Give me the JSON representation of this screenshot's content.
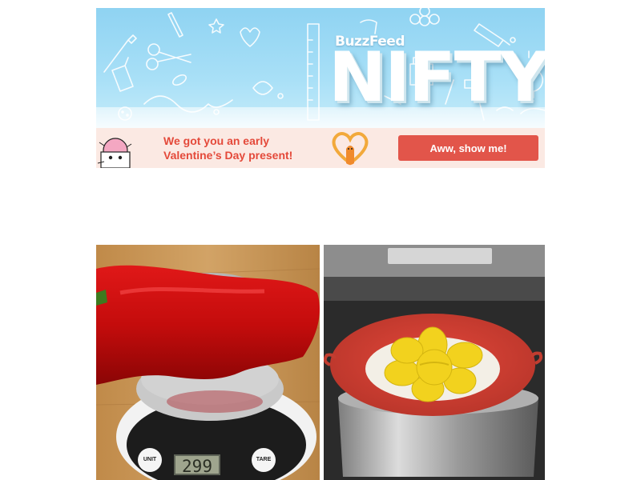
{
  "banner": {
    "brand": "BuzzFeed",
    "title": "NIFTY",
    "illustration_icons": [
      "scissors-icon",
      "lightbulb-icon",
      "hammer-icon",
      "paintbrush-icon",
      "pencil-icon",
      "glue-bottle-icon",
      "ruler-icon",
      "leaf-icon",
      "button-icon",
      "safety-pin-icon"
    ],
    "colors": {
      "sky": "#8fd3f2",
      "doodle": "#ffffff"
    }
  },
  "promo": {
    "message_line1": "We got you an early",
    "message_line2": "Valentine’s Day present!",
    "cta_label": "Aww, show me!",
    "colors": {
      "background": "#fbe9e3",
      "accent": "#e4493a",
      "button": "#e2554a"
    }
  },
  "photos": {
    "left": {
      "subject": "red-pepper-on-kitchen-scale",
      "scale_unit_label": "UNIT",
      "scale_tare_label": "TARE",
      "scale_readout": "299"
    },
    "right": {
      "subject": "flower-spill-stopper-lid-on-pot"
    }
  }
}
